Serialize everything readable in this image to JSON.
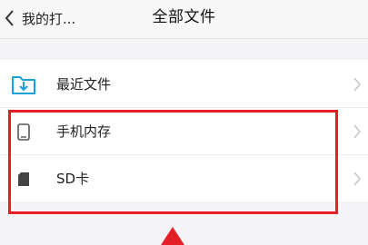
{
  "nav": {
    "back_label": "我的打...",
    "title": "全部文件"
  },
  "list": {
    "items": [
      {
        "label": "最近文件",
        "icon": "download-folder-icon"
      },
      {
        "label": "手机内存",
        "icon": "phone-icon"
      },
      {
        "label": "SD卡",
        "icon": "sd-card-icon"
      }
    ]
  },
  "colors": {
    "accent": "#1aa0d8",
    "highlight": "#e51f26"
  }
}
